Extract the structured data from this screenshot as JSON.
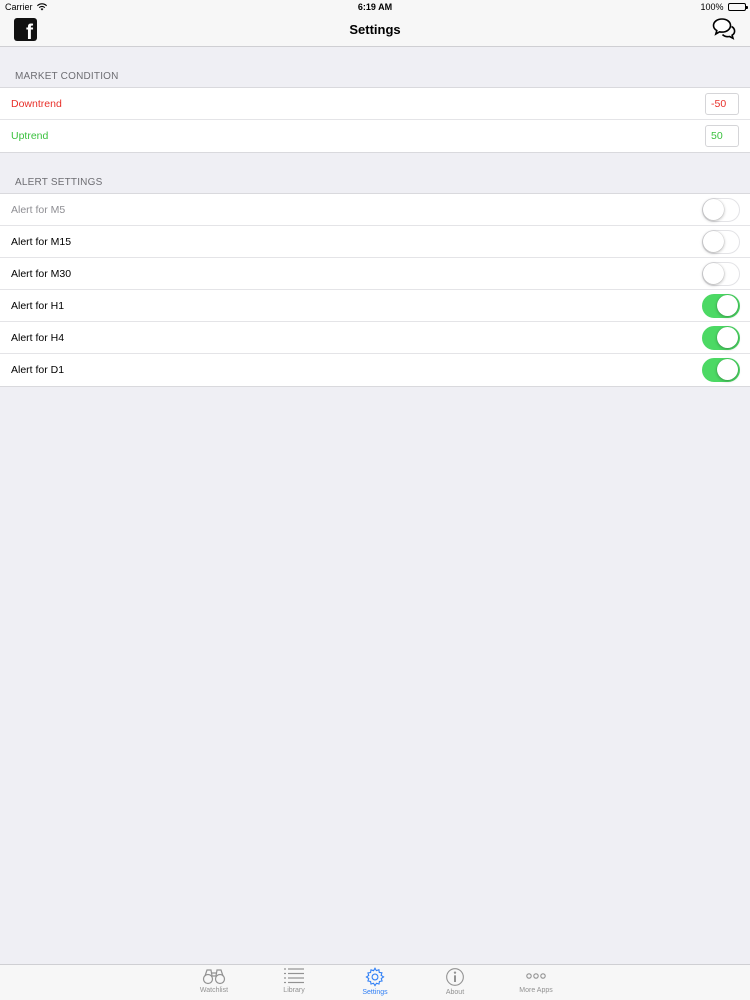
{
  "status_bar": {
    "carrier": "Carrier",
    "time": "6:19 AM",
    "battery": "100%"
  },
  "nav": {
    "title": "Settings",
    "left_icon": "facebook-icon",
    "right_icon": "chat-bubbles-icon"
  },
  "market_condition": {
    "header": "MARKET CONDITION",
    "rows": [
      {
        "label": "Downtrend",
        "value": "-50",
        "color": "#e8302a"
      },
      {
        "label": "Uptrend",
        "value": "50",
        "color": "#3bc13f"
      }
    ]
  },
  "alert_settings": {
    "header": "ALERT SETTINGS",
    "rows": [
      {
        "label": "Alert for M5",
        "on": false,
        "dimmed": true
      },
      {
        "label": "Alert for M15",
        "on": false
      },
      {
        "label": "Alert for M30",
        "on": false
      },
      {
        "label": "Alert for H1",
        "on": true
      },
      {
        "label": "Alert for H4",
        "on": true
      },
      {
        "label": "Alert for D1",
        "on": true
      }
    ]
  },
  "tabs": [
    {
      "label": "Watchlist",
      "icon": "binoculars-icon",
      "active": false
    },
    {
      "label": "Library",
      "icon": "list-icon",
      "active": false
    },
    {
      "label": "Settings",
      "icon": "gear-icon",
      "active": true
    },
    {
      "label": "About",
      "icon": "info-icon",
      "active": false
    },
    {
      "label": "More Apps",
      "icon": "more-dots-icon",
      "active": false
    }
  ],
  "colors": {
    "accent": "#2f7ff6",
    "toggle_on": "#4cd964",
    "downtrend": "#e8302a",
    "uptrend": "#3bc13f"
  }
}
